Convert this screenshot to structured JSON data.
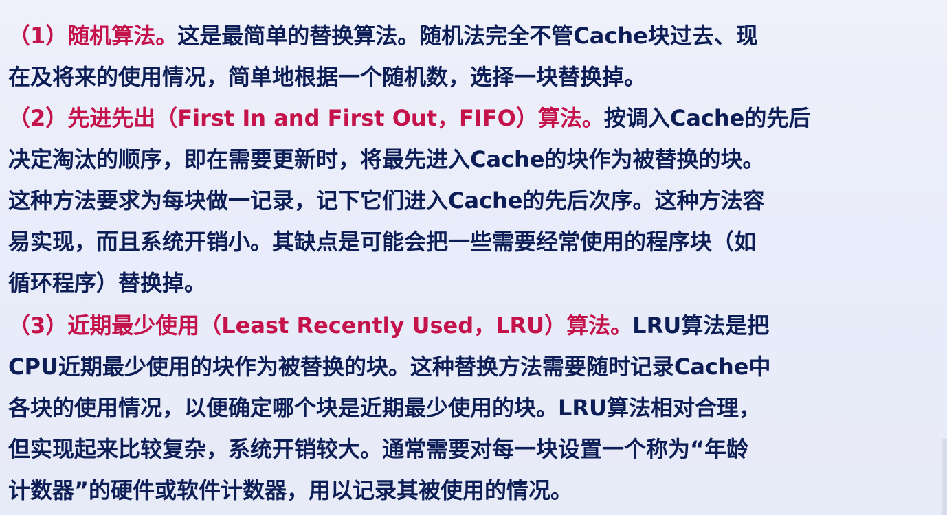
{
  "paragraphs": [
    {
      "id": "random",
      "lines": [
        {
          "red": "（1）随机算法。",
          "text": "这是最简单的替换算法。随机法完全不管Cache块过去、现"
        },
        {
          "text": "在及将来的使用情况，简单地根据一个随机数，选择一块替换掉。"
        }
      ]
    },
    {
      "id": "fifo",
      "lines": [
        {
          "red": "（2）先进先出（First In and First Out，FIFO）算法。",
          "text": "按调入Cache的先后"
        },
        {
          "text": "决定淘汰的顺序，即在需要更新时，将最先进入Cache的块作为被替换的块。"
        },
        {
          "text": "这种方法要求为每块做一记录，记下它们进入Cache的先后次序。这种方法容"
        },
        {
          "text": "易实现，而且系统开销小。其缺点是可能会把一些需要经常使用的程序块（如"
        },
        {
          "text": "循环程序）替换掉。"
        }
      ]
    },
    {
      "id": "lru",
      "lines": [
        {
          "red": "（3）近期最少使用（Least Recently Used，LRU）算法。",
          "text": "LRU算法是把"
        },
        {
          "text": "CPU近期最少使用的块作为被替换的块。这种替换方法需要随时记录Cache中"
        },
        {
          "text": "各块的使用情况，以便确定哪个块是近期最少使用的块。LRU算法相对合理，"
        },
        {
          "text": "但实现起来比较复杂，系统开销较大。通常需要对每一块设置一个称为“年龄"
        },
        {
          "text": "计数器”的硬件或软件计数器，用以记录其被使用的情况。"
        }
      ]
    }
  ],
  "colors": {
    "highlight": "#c4124a",
    "body_text": "#182040",
    "background": "#eceffa"
  }
}
